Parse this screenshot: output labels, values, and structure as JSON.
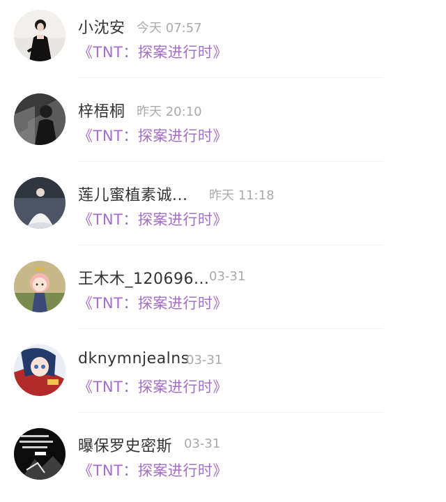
{
  "messages": [
    {
      "name": "小沈安",
      "time": "今天 07:57",
      "subtitle": "《TNT：探案进行时》",
      "avatar_icon": "woman-black-dress-avatar"
    },
    {
      "name": "梓梧桐",
      "time": "昨天 20:10",
      "subtitle": "《TNT：探案进行时》",
      "avatar_icon": "dark-staircase-avatar"
    },
    {
      "name": "莲儿蜜植素诚...",
      "time": "昨天 11:18",
      "subtitle": "《TNT：探案进行时》",
      "avatar_icon": "white-dress-avatar"
    },
    {
      "name": "王木木_120696...",
      "time": "03-31",
      "subtitle": "《TNT：探案进行时》",
      "avatar_icon": "anime-girl-crown-avatar"
    },
    {
      "name": "dknymnjealns",
      "time": "03-31",
      "subtitle": "《TNT：探案进行时》",
      "avatar_icon": "anime-character-avatar"
    },
    {
      "name": "曝保罗史密斯",
      "time": "03-31",
      "subtitle": "《TNT：探案进行时》",
      "avatar_icon": "black-white-graphic-avatar"
    }
  ],
  "colors": {
    "name": "#333333",
    "time": "#aaaaaa",
    "subtitle": "#a36fc6",
    "background": "#ffffff"
  }
}
